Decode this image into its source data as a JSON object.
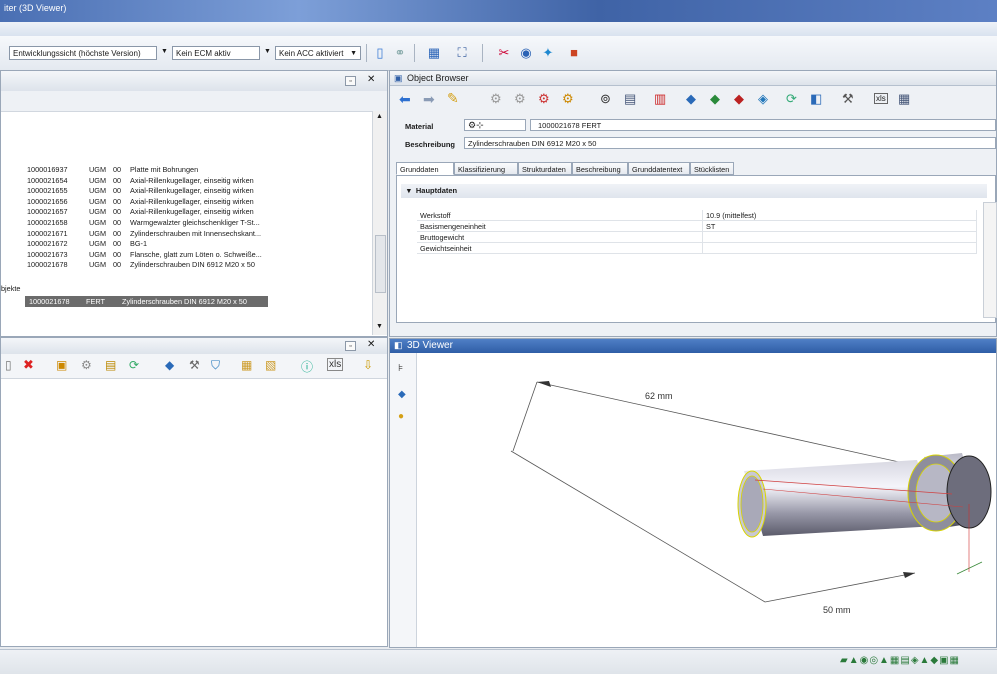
{
  "window": {
    "title": "iter (3D Viewer)"
  },
  "toolbar": {
    "view_select": "Entwicklungssicht (höchste Version)",
    "ecm_select": "Kein ECM aktiv",
    "acc_select": "Kein ACC aktiviert"
  },
  "result_list": {
    "rows": [
      {
        "number": "1000016937",
        "type": "UGM",
        "version": "00",
        "description": "Platte mit Bohrungen"
      },
      {
        "number": "1000021654",
        "type": "UGM",
        "version": "00",
        "description": "Axial-Rillenkugellager, einseitig wirken"
      },
      {
        "number": "1000021655",
        "type": "UGM",
        "version": "00",
        "description": "Axial-Rillenkugellager, einseitig wirken"
      },
      {
        "number": "1000021656",
        "type": "UGM",
        "version": "00",
        "description": "Axial-Rillenkugellager, einseitig wirken"
      },
      {
        "number": "1000021657",
        "type": "UGM",
        "version": "00",
        "description": "Axial-Rillenkugellager, einseitig wirken"
      },
      {
        "number": "1000021658",
        "type": "UGM",
        "version": "00",
        "description": "Warmgewalzter gleichschenkliger T-St..."
      },
      {
        "number": "1000021671",
        "type": "UGM",
        "version": "00",
        "description": "Zylinderschrauben mit Innensechskant..."
      },
      {
        "number": "1000021672",
        "type": "UGM",
        "version": "00",
        "description": "BG-1"
      },
      {
        "number": "1000021673",
        "type": "UGM",
        "version": "00",
        "description": "Flansche, glatt zum Löten o. Schweiße..."
      },
      {
        "number": "1000021678",
        "type": "UGM",
        "version": "00",
        "description": "Zylinderschrauben DIN 6912 M20 x 50"
      }
    ],
    "group_label": "bjekte",
    "selected": {
      "number": "1000021678",
      "type": "FERT",
      "description": "Zylinderschrauben DIN 6912 M20 x 50"
    }
  },
  "object_browser": {
    "title": "Object Browser",
    "material_label": "Material",
    "material_value": "1000021678 FERT",
    "beschreibung_label": "Beschreibung",
    "beschreibung_value": "Zylinderschrauben DIN 6912 M20 x 50",
    "tabs": [
      "Grunddaten",
      "Klassifizierung",
      "Strukturdaten",
      "Beschreibung",
      "Grunddatentext",
      "Stücklisten"
    ],
    "section_title": "Hauptdaten",
    "fields": [
      {
        "label": "Werkstoff",
        "value": "10.9 (mittelfest)"
      },
      {
        "label": "Basismengeneinheit",
        "value": "ST"
      },
      {
        "label": "Bruttogewicht",
        "value": ""
      },
      {
        "label": "Gewichtseinheit",
        "value": ""
      }
    ]
  },
  "viewer": {
    "title": "3D Viewer",
    "dimension_length": "62 mm",
    "dimension_shank": "50 mm"
  },
  "colors": {
    "header_blue": "#2f5ea6",
    "selection": "#6b6b6b",
    "accent_red": "#d03030"
  }
}
